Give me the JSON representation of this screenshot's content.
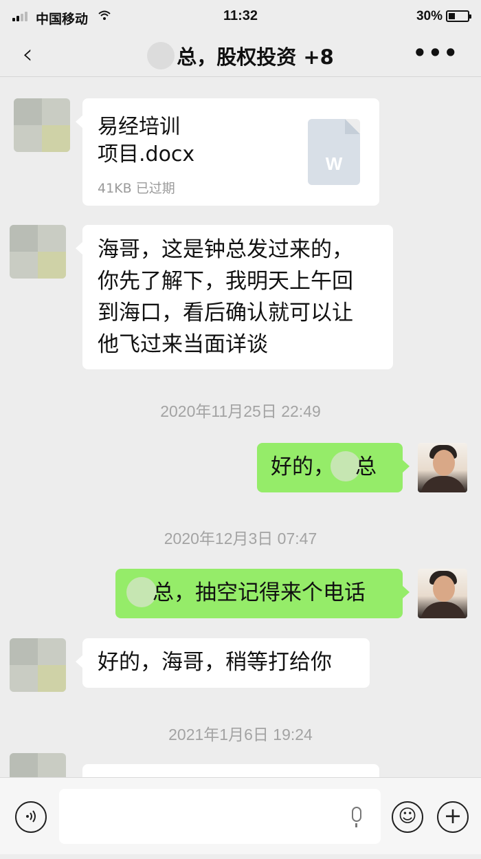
{
  "status_bar": {
    "carrier": "中国移动",
    "wifi_icon": "wifi-icon",
    "time": "11:32",
    "battery": "30%",
    "battery_level": 0.3
  },
  "header": {
    "back_icon": "‹",
    "title": "总，股权投资 +8",
    "more_icon": "•••"
  },
  "messages": [
    {
      "type": "file",
      "side": "left",
      "file_name_line1": "易经培训",
      "file_name_line2": "项目.docx",
      "file_meta": "41KB  已过期",
      "file_icon_letter": "W"
    },
    {
      "type": "text",
      "side": "left",
      "lines": [
        "海哥，这是钟总发过来的，",
        "你先了解下，我明天上午回",
        "到海口，看后确认就可以让",
        "他飞过来当面详谈"
      ]
    },
    {
      "type": "timestamp",
      "text": "2020年11月25日 22:49"
    },
    {
      "type": "text",
      "side": "right",
      "prefix": "好的，",
      "suffix": "总"
    },
    {
      "type": "timestamp",
      "text": "2020年12月3日 07:47"
    },
    {
      "type": "text",
      "side": "right",
      "suffix": "总，抽空记得来个电话"
    },
    {
      "type": "text",
      "side": "left",
      "text": "好的，海哥，稍等打给你"
    },
    {
      "type": "timestamp",
      "text": "2021年1月6日 19:24"
    }
  ],
  "input_bar": {
    "voice_icon": "voice-icon",
    "emoji_icon": "☺",
    "plus_icon": "+"
  }
}
